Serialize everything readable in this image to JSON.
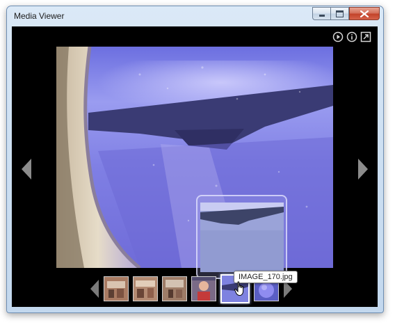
{
  "window": {
    "title": "Media Viewer"
  },
  "toolbar": {
    "icons": [
      "play-icon",
      "info-icon",
      "fullscreen-icon"
    ]
  },
  "viewer": {
    "current_image": "IMAGE_170.jpg",
    "image_description_colors": {
      "sky": "#8a86e8",
      "wing": "#3a3b74",
      "frame": "#d8c8a8"
    }
  },
  "filmstrip": {
    "thumbnail_count": 6,
    "selected_index": 4,
    "tooltip": "IMAGE_170.jpg"
  },
  "colors": {
    "stage_bg": "#000000",
    "title_bar": "#cfe1f3",
    "close_button": "#c3432a"
  }
}
